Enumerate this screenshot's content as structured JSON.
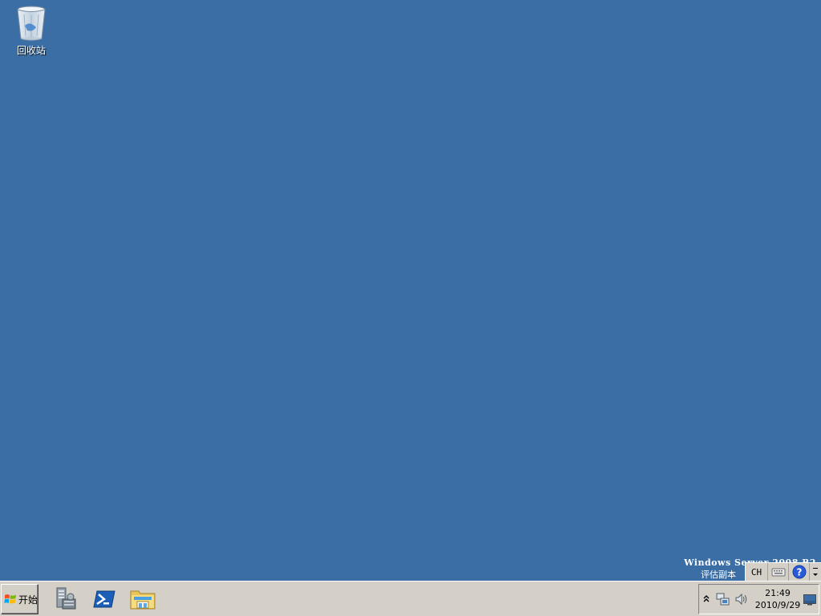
{
  "desktop": {
    "background_color": "#3a6ea5",
    "icons": [
      {
        "label": "回收站",
        "icon": "recycle-bin-icon"
      }
    ],
    "watermark": {
      "product": "Windows Server 2008 R2",
      "edition": "评估副本"
    }
  },
  "language_bar": {
    "language": "CH",
    "items": [
      "keyboard-icon",
      "help-icon",
      "options-icon"
    ]
  },
  "taskbar": {
    "start_label": "开始",
    "quick_launch": [
      {
        "icon": "server-manager-icon"
      },
      {
        "icon": "powershell-icon"
      },
      {
        "icon": "windows-explorer-icon"
      }
    ],
    "tray": {
      "time": "21:49",
      "date": "2010/9/29",
      "icons": [
        "show-hidden-icons-icon",
        "network-icon",
        "volume-icon",
        "show-desktop-icon"
      ]
    }
  }
}
